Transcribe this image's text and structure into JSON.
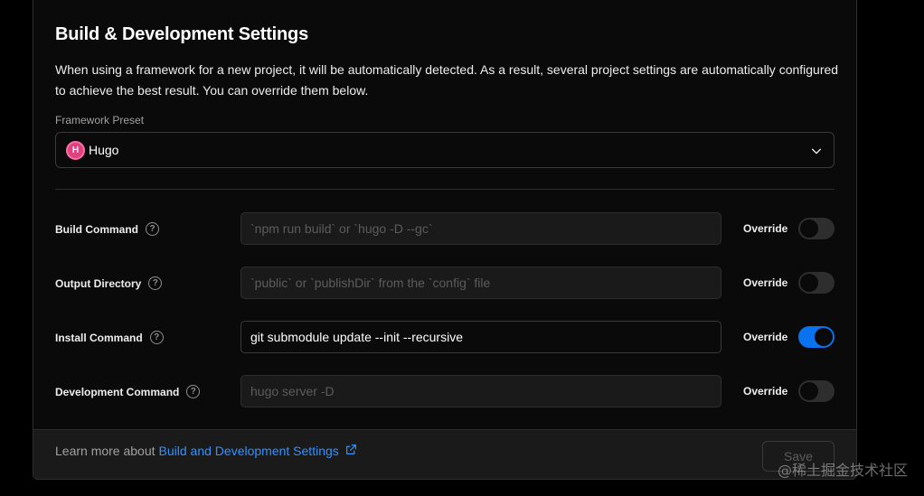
{
  "section": {
    "title": "Build & Development Settings",
    "description": "When using a framework for a new project, it will be automatically detected. As a result, several project settings are automatically configured to achieve the best result. You can override them below."
  },
  "preset": {
    "label": "Framework Preset",
    "value": "Hugo",
    "logo_letter": "H",
    "icon": "hugo-logo"
  },
  "rows": [
    {
      "label": "Build Command",
      "placeholder": "`npm run build` or `hugo -D --gc`",
      "value": "",
      "override_label": "Override",
      "override_on": false
    },
    {
      "label": "Output Directory",
      "placeholder": "`public` or `publishDir` from the `config` file",
      "value": "",
      "override_label": "Override",
      "override_on": false
    },
    {
      "label": "Install Command",
      "placeholder": "",
      "value": "git submodule update --init --recursive",
      "override_label": "Override",
      "override_on": true
    },
    {
      "label": "Development Command",
      "placeholder": "hugo server -D",
      "value": "",
      "override_label": "Override",
      "override_on": false
    }
  ],
  "help_glyph": "?",
  "footer": {
    "text": "Learn more about",
    "link": "Build and Development Settings",
    "save_label": "Save"
  },
  "watermark": "@稀土掘金技术社区",
  "colors": {
    "accent": "#0a72ef",
    "link": "#3291ff",
    "hugo": "#e0417f",
    "background": "#000000",
    "card": "#0a0a0a"
  }
}
